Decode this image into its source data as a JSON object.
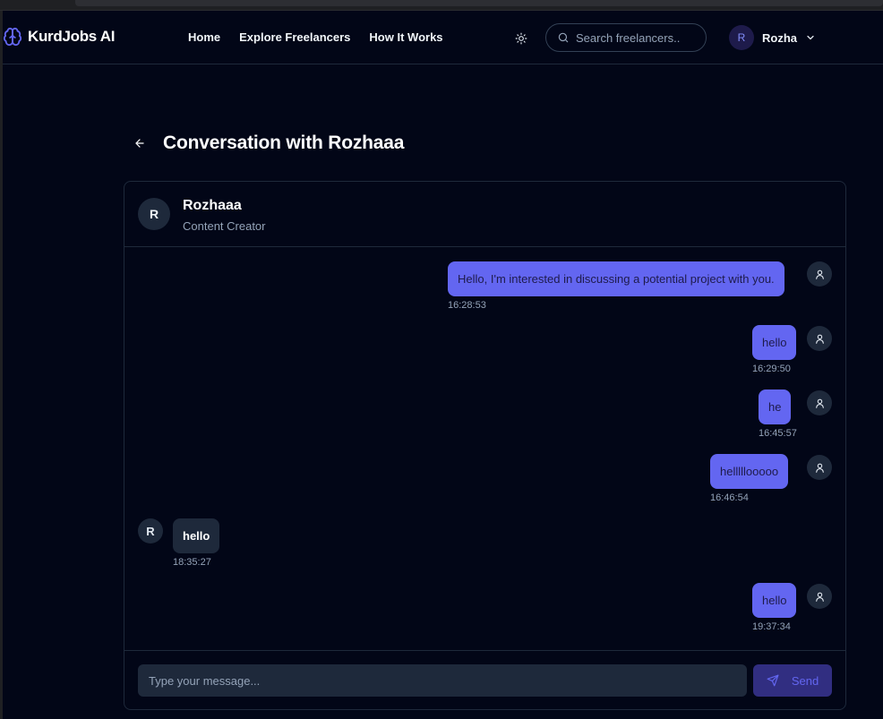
{
  "app": {
    "name": "KurdJobs AI"
  },
  "nav": {
    "items": [
      "Home",
      "Explore Freelancers",
      "How It Works"
    ]
  },
  "search": {
    "placeholder": "Search freelancers.."
  },
  "user": {
    "initial": "R",
    "name": "Rozha"
  },
  "page": {
    "title": "Conversation with Rozhaaa"
  },
  "contact": {
    "initial": "R",
    "name": "Rozhaaa",
    "role": "Content Creator"
  },
  "messages": [
    {
      "direction": "sent",
      "text": "Hello, I'm interested in discussing a potential project with you.",
      "time": "16:28:53"
    },
    {
      "direction": "sent",
      "text": "hello",
      "time": "16:29:50"
    },
    {
      "direction": "sent",
      "text": "he",
      "time": "16:45:57"
    },
    {
      "direction": "sent",
      "text": "helllllooooo",
      "time": "16:46:54"
    },
    {
      "direction": "received",
      "sender_initial": "R",
      "text": "hello",
      "time": "18:35:27"
    },
    {
      "direction": "sent",
      "text": "hello",
      "time": "19:37:34"
    }
  ],
  "composer": {
    "placeholder": "Type your message...",
    "send_label": "Send"
  },
  "colors": {
    "background": "#020617",
    "accent": "#6366f1",
    "accent_dark": "#312e81",
    "surface": "#1e293b",
    "border": "#1e293b",
    "muted_text": "#94a3b8"
  },
  "icons": {
    "logo": "brain-icon",
    "theme": "sun-icon",
    "search": "search-icon",
    "user_menu": "chevron-down-icon",
    "back": "arrow-left-icon",
    "sent_avatar": "user-icon",
    "send": "send-icon"
  }
}
